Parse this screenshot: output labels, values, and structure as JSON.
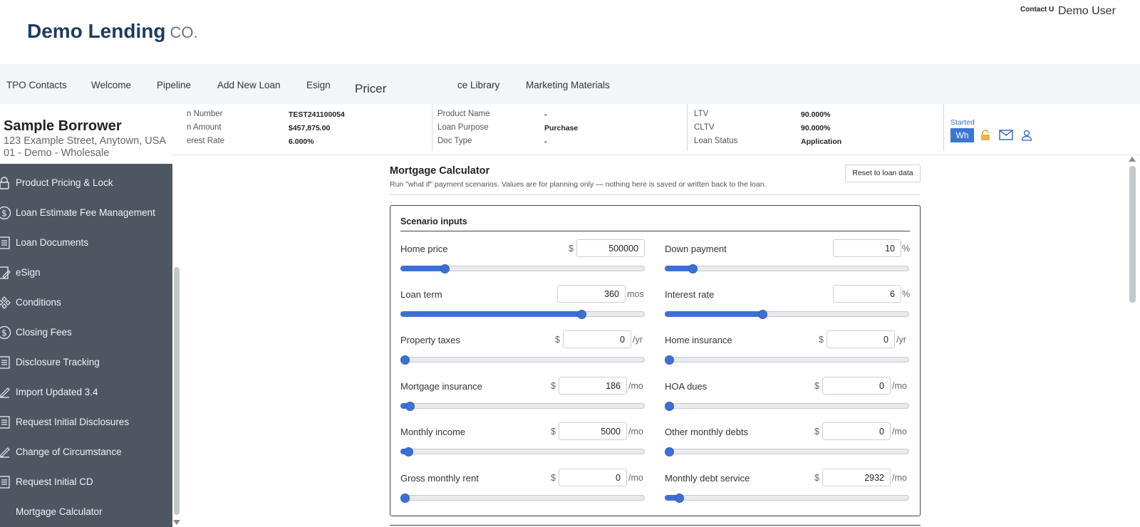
{
  "header": {
    "brand": "Demo Lending",
    "brand_suffix": "CO.",
    "contact_link": "Contact Us",
    "user": "Demo User"
  },
  "nav": {
    "items": [
      "TPO Contacts",
      "Welcome",
      "Pipeline",
      "Add New Loan",
      "Esign"
    ],
    "active": "Pricer",
    "more": [
      "ce Library",
      "Marketing Materials"
    ]
  },
  "borrower": {
    "name": "Sample Borrower",
    "address": "123 Example Street, Anytown, USA",
    "channel": "01 - Demo - Wholesale"
  },
  "summary": {
    "col1": [
      {
        "label": "n Number",
        "value": "TEST241100054"
      },
      {
        "label": "n Amount",
        "value": "$457,875.00"
      },
      {
        "label": "erest Rate",
        "value": "6.000%"
      }
    ],
    "col2": [
      {
        "label": "Product Name",
        "value": "-"
      },
      {
        "label": "Loan Purpose",
        "value": "Purchase"
      },
      {
        "label": "Doc Type",
        "value": "-"
      }
    ],
    "col3": [
      {
        "label": "LTV",
        "value": "90.000%"
      },
      {
        "label": "CLTV",
        "value": "90.000%"
      },
      {
        "label": "Loan Status",
        "value": "Application"
      }
    ],
    "started": "Started",
    "badge": "Wh",
    "icons": [
      "lock-icon",
      "mail-icon",
      "user-icon"
    ]
  },
  "sidebar": {
    "items": [
      {
        "label": "Product Pricing & Lock",
        "icon": "lock-icon"
      },
      {
        "label": "Loan Estimate Fee Management",
        "icon": "dollar-icon"
      },
      {
        "label": "Loan Documents",
        "icon": "document-icon"
      },
      {
        "label": "eSign",
        "icon": "esign-icon"
      },
      {
        "label": "Conditions",
        "icon": "conditions-icon"
      },
      {
        "label": "Closing Fees",
        "icon": "dollar-icon"
      },
      {
        "label": "Disclosure Tracking",
        "icon": "document-icon"
      },
      {
        "label": "Import Updated 3.4",
        "icon": "import-icon"
      },
      {
        "label": "Request Initial Disclosures",
        "icon": "document-icon"
      },
      {
        "label": "Change of Circumstance",
        "icon": "edit-icon"
      },
      {
        "label": "Request Initial CD",
        "icon": "document-icon"
      },
      {
        "label": "Mortgage Calculator",
        "icon": ""
      }
    ]
  },
  "calculator": {
    "title": "Mortgage Calculator",
    "subtitle": "Run \"what if\" payment scenarios. Values are for planning only — nothing here is saved or written back to the loan.",
    "reset_label": "Reset to loan data",
    "panel_title": "Scenario inputs",
    "fields": [
      {
        "name": "home-price",
        "label": "Home price",
        "prefix": "$",
        "value": "500000",
        "unit": "",
        "level": 0.18
      },
      {
        "name": "down-payment",
        "label": "Down payment",
        "prefix": "",
        "value": "10",
        "unit": "%",
        "level": 0.115
      },
      {
        "name": "loan-term",
        "label": "Loan term",
        "prefix": "",
        "value": "360",
        "unit": "mos",
        "level": 0.74
      },
      {
        "name": "interest-rate",
        "label": "Interest rate",
        "prefix": "",
        "value": "6",
        "unit": "%",
        "level": 0.4
      },
      {
        "name": "property-taxes",
        "label": "Property taxes",
        "prefix": "$",
        "value": "0",
        "unit": "/yr",
        "level": 0.0
      },
      {
        "name": "home-insurance",
        "label": "Home insurance",
        "prefix": "$",
        "value": "0",
        "unit": "/yr",
        "level": 0.0
      },
      {
        "name": "mortgage-insurance",
        "label": "Mortgage insurance",
        "prefix": "$",
        "value": "186",
        "unit": "/mo",
        "level": 0.037
      },
      {
        "name": "hoa-dues",
        "label": "HOA dues",
        "prefix": "$",
        "value": "0",
        "unit": "/mo",
        "level": 0.0
      },
      {
        "name": "monthly-income",
        "label": "Monthly income",
        "prefix": "$",
        "value": "5000",
        "unit": "/mo",
        "level": 0.033
      },
      {
        "name": "other-monthly-debts",
        "label": "Other monthly debts",
        "prefix": "$",
        "value": "0",
        "unit": "/mo",
        "level": 0.0
      },
      {
        "name": "gross-monthly-rent",
        "label": "Gross monthly rent",
        "prefix": "$",
        "value": "0",
        "unit": "/mo",
        "level": 0.0
      },
      {
        "name": "monthly-debt-service",
        "label": "Monthly debt service",
        "prefix": "$",
        "value": "2932",
        "unit": "/mo",
        "level": 0.057
      }
    ]
  },
  "colors": {
    "brand": "#1f3a5f",
    "sidebar": "#4e5661",
    "accent": "#3e70d4",
    "nav_bg": "#f3f6f9"
  }
}
